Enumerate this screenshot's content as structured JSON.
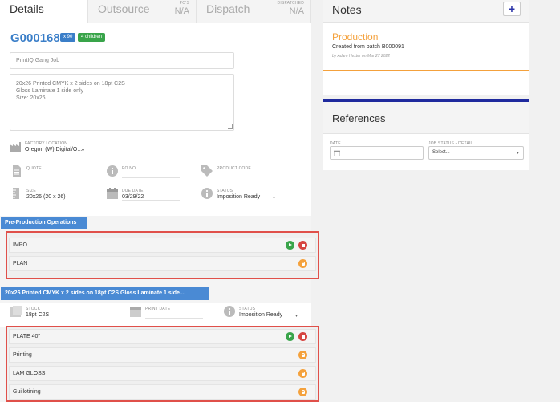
{
  "tabs": {
    "details": "Details",
    "outsource": "Outsource",
    "pos_caption": "PO'S",
    "pos_value": "N/A",
    "dispatch": "Dispatch",
    "dispatched_caption": "DISPATCHED",
    "dispatched_value": "N/A"
  },
  "job": {
    "number": "G000168",
    "qty_badge": "x 90",
    "children_badge": "4 children",
    "title_placeholder": "PrintIQ Gang Job",
    "description_lines": [
      "20x26  Printed CMYK x 2 sides  on 18pt C2S",
      "Gloss Laminate 1 side only",
      "Size: 20x26"
    ],
    "factory_label": "FACTORY LOCATION",
    "factory_value": "Oregon (W) Digital/O...",
    "quote_label": "QUOTE",
    "po_label": "PO NO.",
    "product_code_label": "PRODUCT CODE",
    "size_label": "SIZE",
    "size_value": "20x26 (20 x 26)",
    "due_label": "DUE DATE",
    "due_value": "03/29/22",
    "status_label": "STATUS",
    "status_value": "Imposition Ready"
  },
  "preprod": {
    "header": "Pre-Production Operations",
    "ops": [
      {
        "label": "IMPO"
      },
      {
        "label": "PLAN"
      }
    ]
  },
  "component": {
    "header": "20x26 Printed CMYK x 2 sides on 18pt C2S Gloss Laminate 1 side...",
    "stock_label": "STOCK",
    "stock_value": "18pt C2S",
    "print_date_label": "PRINT DATE",
    "status_label": "STATUS",
    "status_value": "Imposition Ready",
    "ops": [
      {
        "label": "PLATE 40\""
      },
      {
        "label": "Printing"
      },
      {
        "label": "LAM GLOSS"
      },
      {
        "label": "Guillotining"
      }
    ]
  },
  "notes": {
    "title": "Notes",
    "add_label": "+",
    "entry_title": "Production",
    "entry_body": "Created from batch B000091",
    "entry_meta": "by Adam Hexter on Mar 27 2022"
  },
  "references": {
    "title": "References",
    "date_label": "DATE",
    "job_status_label": "JOB STATUS - DETAIL",
    "job_status_value": "Select..."
  },
  "colors": {
    "accent_blue": "#3a7ec8",
    "section_blue": "#4a8ad4",
    "highlight_red": "#e0504a",
    "orange": "#f4a13c",
    "green": "#39a44a",
    "navy": "#1f2a9e"
  }
}
